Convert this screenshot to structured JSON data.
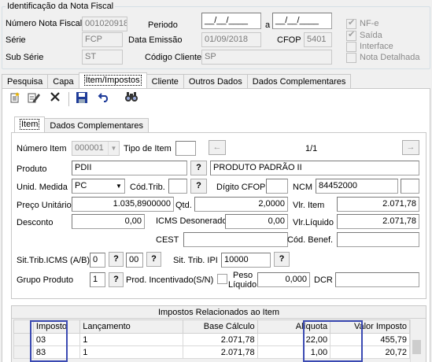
{
  "header": {
    "legend": "Identificação da Nota Fiscal",
    "numero_label": "Número Nota Fiscal",
    "numero_value": "001020918",
    "serie_label": "Série",
    "serie_value": "FCP",
    "subserie_label": "Sub Série",
    "subserie_value": "ST",
    "periodo_label": "Periodo",
    "periodo_from": "__/__/____",
    "periodo_a": "a",
    "periodo_to": "__/__/____",
    "emissao_label": "Data Emissão",
    "emissao_value": "01/09/2018",
    "cfop_label": "CFOP",
    "cfop_value": "5401",
    "cliente_label": "Código Cliente",
    "cliente_value": "SP",
    "checks": [
      {
        "label": "NF-e",
        "checked": true
      },
      {
        "label": "Saída",
        "checked": true
      },
      {
        "label": "Interface",
        "checked": false
      },
      {
        "label": "Nota Detalhada",
        "checked": false
      }
    ]
  },
  "main_tabs": [
    "Pesquisa",
    "Capa",
    "Item/Impostos",
    "Cliente",
    "Outros Dados",
    "Dados Complementares"
  ],
  "toolbar": {
    "icons": [
      "new-icon",
      "edit-icon",
      "delete-icon",
      "save-icon",
      "undo-icon",
      "find-icon"
    ]
  },
  "item_tabs": [
    "Item",
    "Dados Complementares"
  ],
  "item": {
    "numero_label": "Número Item",
    "numero_value": "000001",
    "tipo_label": "Tipo de Item",
    "tipo_value": "",
    "prev_glyph": "←",
    "next_glyph": "→",
    "pager": "1/1",
    "produto_label": "Produto",
    "produto_code": "PDII",
    "lookup_glyph": "?",
    "produto_desc": "PRODUTO PADRÃO II",
    "unid_label": "Unid. Medida",
    "unid_value": "PC",
    "codtrib_label": "Cód.Trib.",
    "codtrib_value": "",
    "digito_label": "Dígito CFOP",
    "digito_value": "",
    "ncm_label": "NCM",
    "ncm_value": "84452000",
    "ncm_extra": "",
    "preco_label": "Preço Unitário",
    "preco_value": "1.035,8900000",
    "qtd_label": "Qtd.",
    "qtd_value": "2,0000",
    "vlritem_label": "Vlr. Item",
    "vlritem_value": "2.071,78",
    "desconto_label": "Desconto",
    "desconto_value": "0,00",
    "icmsdes_label": "ICMS Desonerado",
    "icmsdes_value": "0,00",
    "vlrliq_label": "Vlr.Líquido",
    "vlrliq_value": "2.071,78",
    "cest_label": "CEST",
    "cest_value": "",
    "codbenef_label": "Cód. Benef.",
    "codbenef_value": "",
    "sittrib_label": "Sit.Trib.ICMS (A/B)",
    "sittrib_a": "0",
    "sittrib_b": "00",
    "ipi_label": "Sit. Trib. IPI",
    "ipi_value": "10000",
    "grupo_label": "Grupo Produto",
    "grupo_value": "1",
    "incentivado_label": "Prod. Incentivado(S/N)",
    "peso_label_1": "Peso",
    "peso_label_2": "Líquido",
    "peso_value": "0,000",
    "dcr_label": "DCR",
    "dcr_value": ""
  },
  "impostos": {
    "title": "Impostos Relacionados ao Item",
    "columns": [
      "Imposto",
      "Lançamento",
      "Base Cálculo",
      "Alíquota",
      "Valor Imposto"
    ],
    "rows": [
      [
        "03",
        "1",
        "2.071,78",
        "22,00",
        "455,79"
      ],
      [
        "83",
        "1",
        "2.071,78",
        "1,00",
        "20,72"
      ]
    ],
    "highlight_color": "#3c4bb3"
  }
}
